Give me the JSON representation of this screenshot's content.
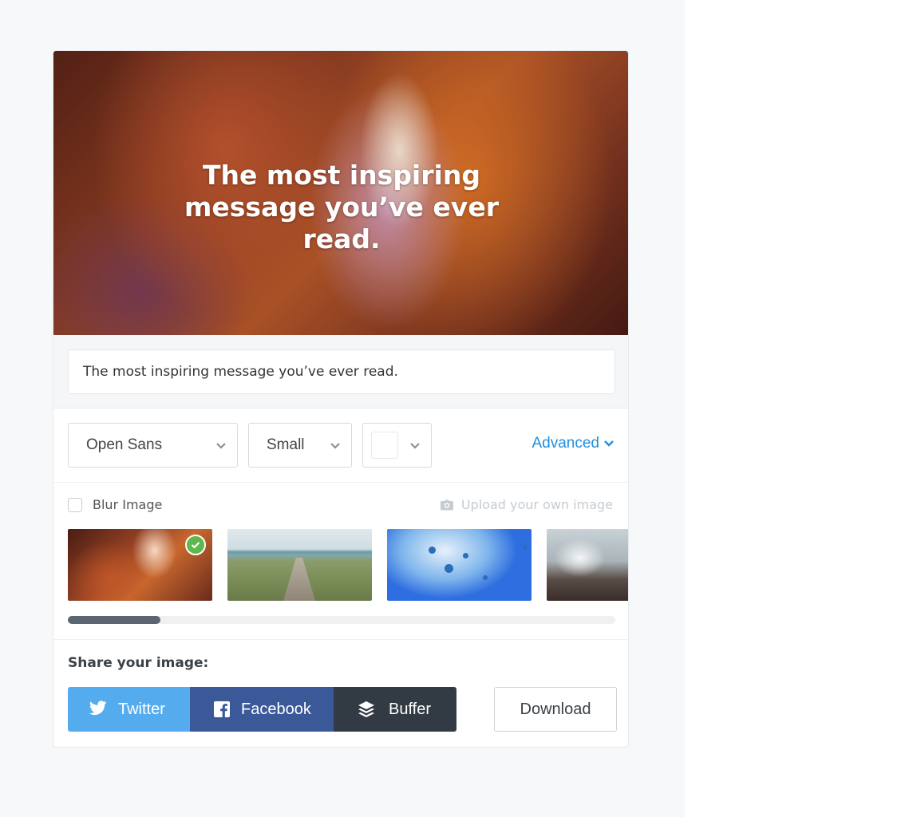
{
  "hero": {
    "title": "The most inspiring message you’ve ever read."
  },
  "message": {
    "value": "The most inspiring message you’ve ever read."
  },
  "controls": {
    "font": "Open Sans",
    "size": "Small",
    "color": "#ffffff",
    "advanced_label": "Advanced"
  },
  "images": {
    "blur_label": "Blur Image",
    "blur_checked": false,
    "upload_label": "Upload your own image",
    "thumbnails": [
      {
        "name": "canyon",
        "selected": true
      },
      {
        "name": "beach-path",
        "selected": false
      },
      {
        "name": "jellyfish",
        "selected": false
      },
      {
        "name": "waves-rocks",
        "selected": false
      }
    ],
    "scroll_position_fraction": 0.0
  },
  "share": {
    "title": "Share your image:",
    "twitter": "Twitter",
    "facebook": "Facebook",
    "buffer": "Buffer",
    "download": "Download"
  },
  "colors": {
    "accent": "#1f8fe0",
    "twitter": "#54acee",
    "facebook": "#3b5998",
    "buffer": "#323b43",
    "selected_badge": "#5fb84b"
  }
}
